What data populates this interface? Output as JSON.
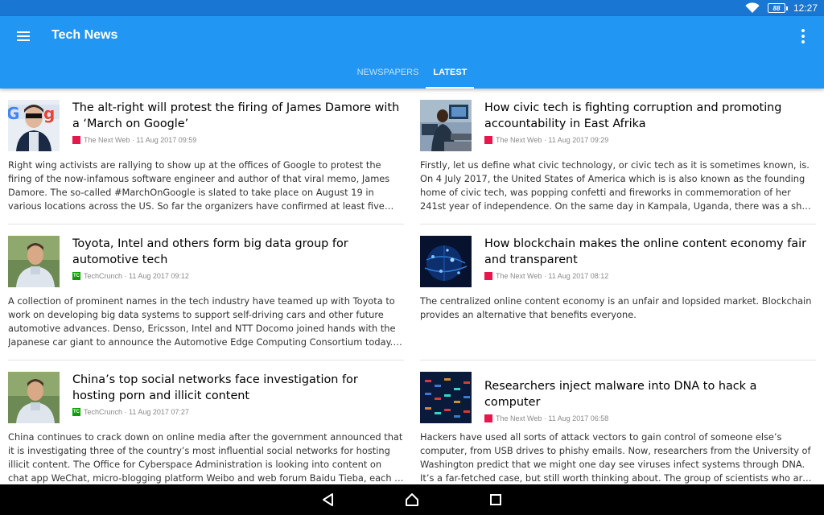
{
  "status_bar": {
    "battery": "88",
    "time": "12:27"
  },
  "app_bar": {
    "title": "Tech News"
  },
  "tabs": [
    {
      "label": "NEWSPAPERS",
      "active": false
    },
    {
      "label": "LATEST",
      "active": true
    }
  ],
  "articles": [
    {
      "title": "The alt-right will protest the firing of James Damore with a ‘March on Google’",
      "source": "The Next Web",
      "date": "11 Aug 2017 09:59",
      "excerpt": "Right wing activists are rallying to show up at the offices of Google to protest the firing of the now-infamous software engineer and author of that viral memo, James Damore. The so-called #MarchOnGoogle is slated to take place on August 19 in various locations across the US. So far the organizers have confirmed at least five cities for the protest and more are expected to follow."
    },
    {
      "title": "How civic tech is fighting corruption and promoting accountability in East Afrika",
      "source": "The Next Web",
      "date": "11 Aug 2017 09:29",
      "excerpt": "Firstly, let us define what civic technology, or civic tech as it is sometimes known, is. On 4 July 2017, the United States of America which is is also known as the founding home of civic tech, was popping confetti and fireworks in commemoration of her 241st year of independence. On the same day in Kampala, Uganda, there was a short announcement."
    },
    {
      "title": "Toyota, Intel and others form big data group for automotive tech",
      "source": "TechCrunch",
      "date": "11 Aug 2017 09:12",
      "excerpt": " A collection of prominent names in the tech industry have teamed up with Toyota to work on developing big data systems to support self-driving cars and other future automotive advances. Denso, Ericsson, Intel and NTT Docomo joined hands with the Japanese car giant to announce the Automotive Edge Computing Consortium today. Read More"
    },
    {
      "title": "How blockchain makes the online content economy fair and transparent",
      "source": "The Next Web",
      "date": "11 Aug 2017 08:12",
      "excerpt": "The centralized online content economy is an unfair and lopsided market. Blockchain provides an alternative that benefits everyone."
    },
    {
      "title": "China’s top social networks face investigation for hosting porn and illicit content",
      "source": "TechCrunch",
      "date": "11 Aug 2017 07:27",
      "excerpt": " China continues to crack down on online media after the government announced that it is investigating three of the country’s most influential social networks for hosting illicit content. The Office for Cyberspace Administration is looking into content on chat app WeChat, micro-blogging platform Weibo and web forum Baidu Tieba, each of which is accused of failing to police content."
    },
    {
      "title": "Researchers inject malware into DNA to hack a computer",
      "source": "The Next Web",
      "date": "11 Aug 2017 06:58",
      "excerpt": "Hackers have used all sorts of attack vectors to gain control of someone else’s computer, from USB drives to phishy emails. Now, researchers from the University of Washington predict that we might one day see viruses infect systems through DNA. It’s a far-fetched case, but still worth thinking about. The group of scientists who are behind the study."
    }
  ],
  "colors": {
    "status_bar": "#1976d2",
    "app_bar": "#2196f3",
    "tnw_brand": "#e8174b",
    "techcrunch_brand": "#0a9e01"
  },
  "icons": {
    "menu": "hamburger-menu-icon",
    "overflow": "more-vertical-icon",
    "wifi": "wifi-icon",
    "back": "back-triangle-icon",
    "home": "home-icon",
    "recents": "recents-square-icon"
  }
}
